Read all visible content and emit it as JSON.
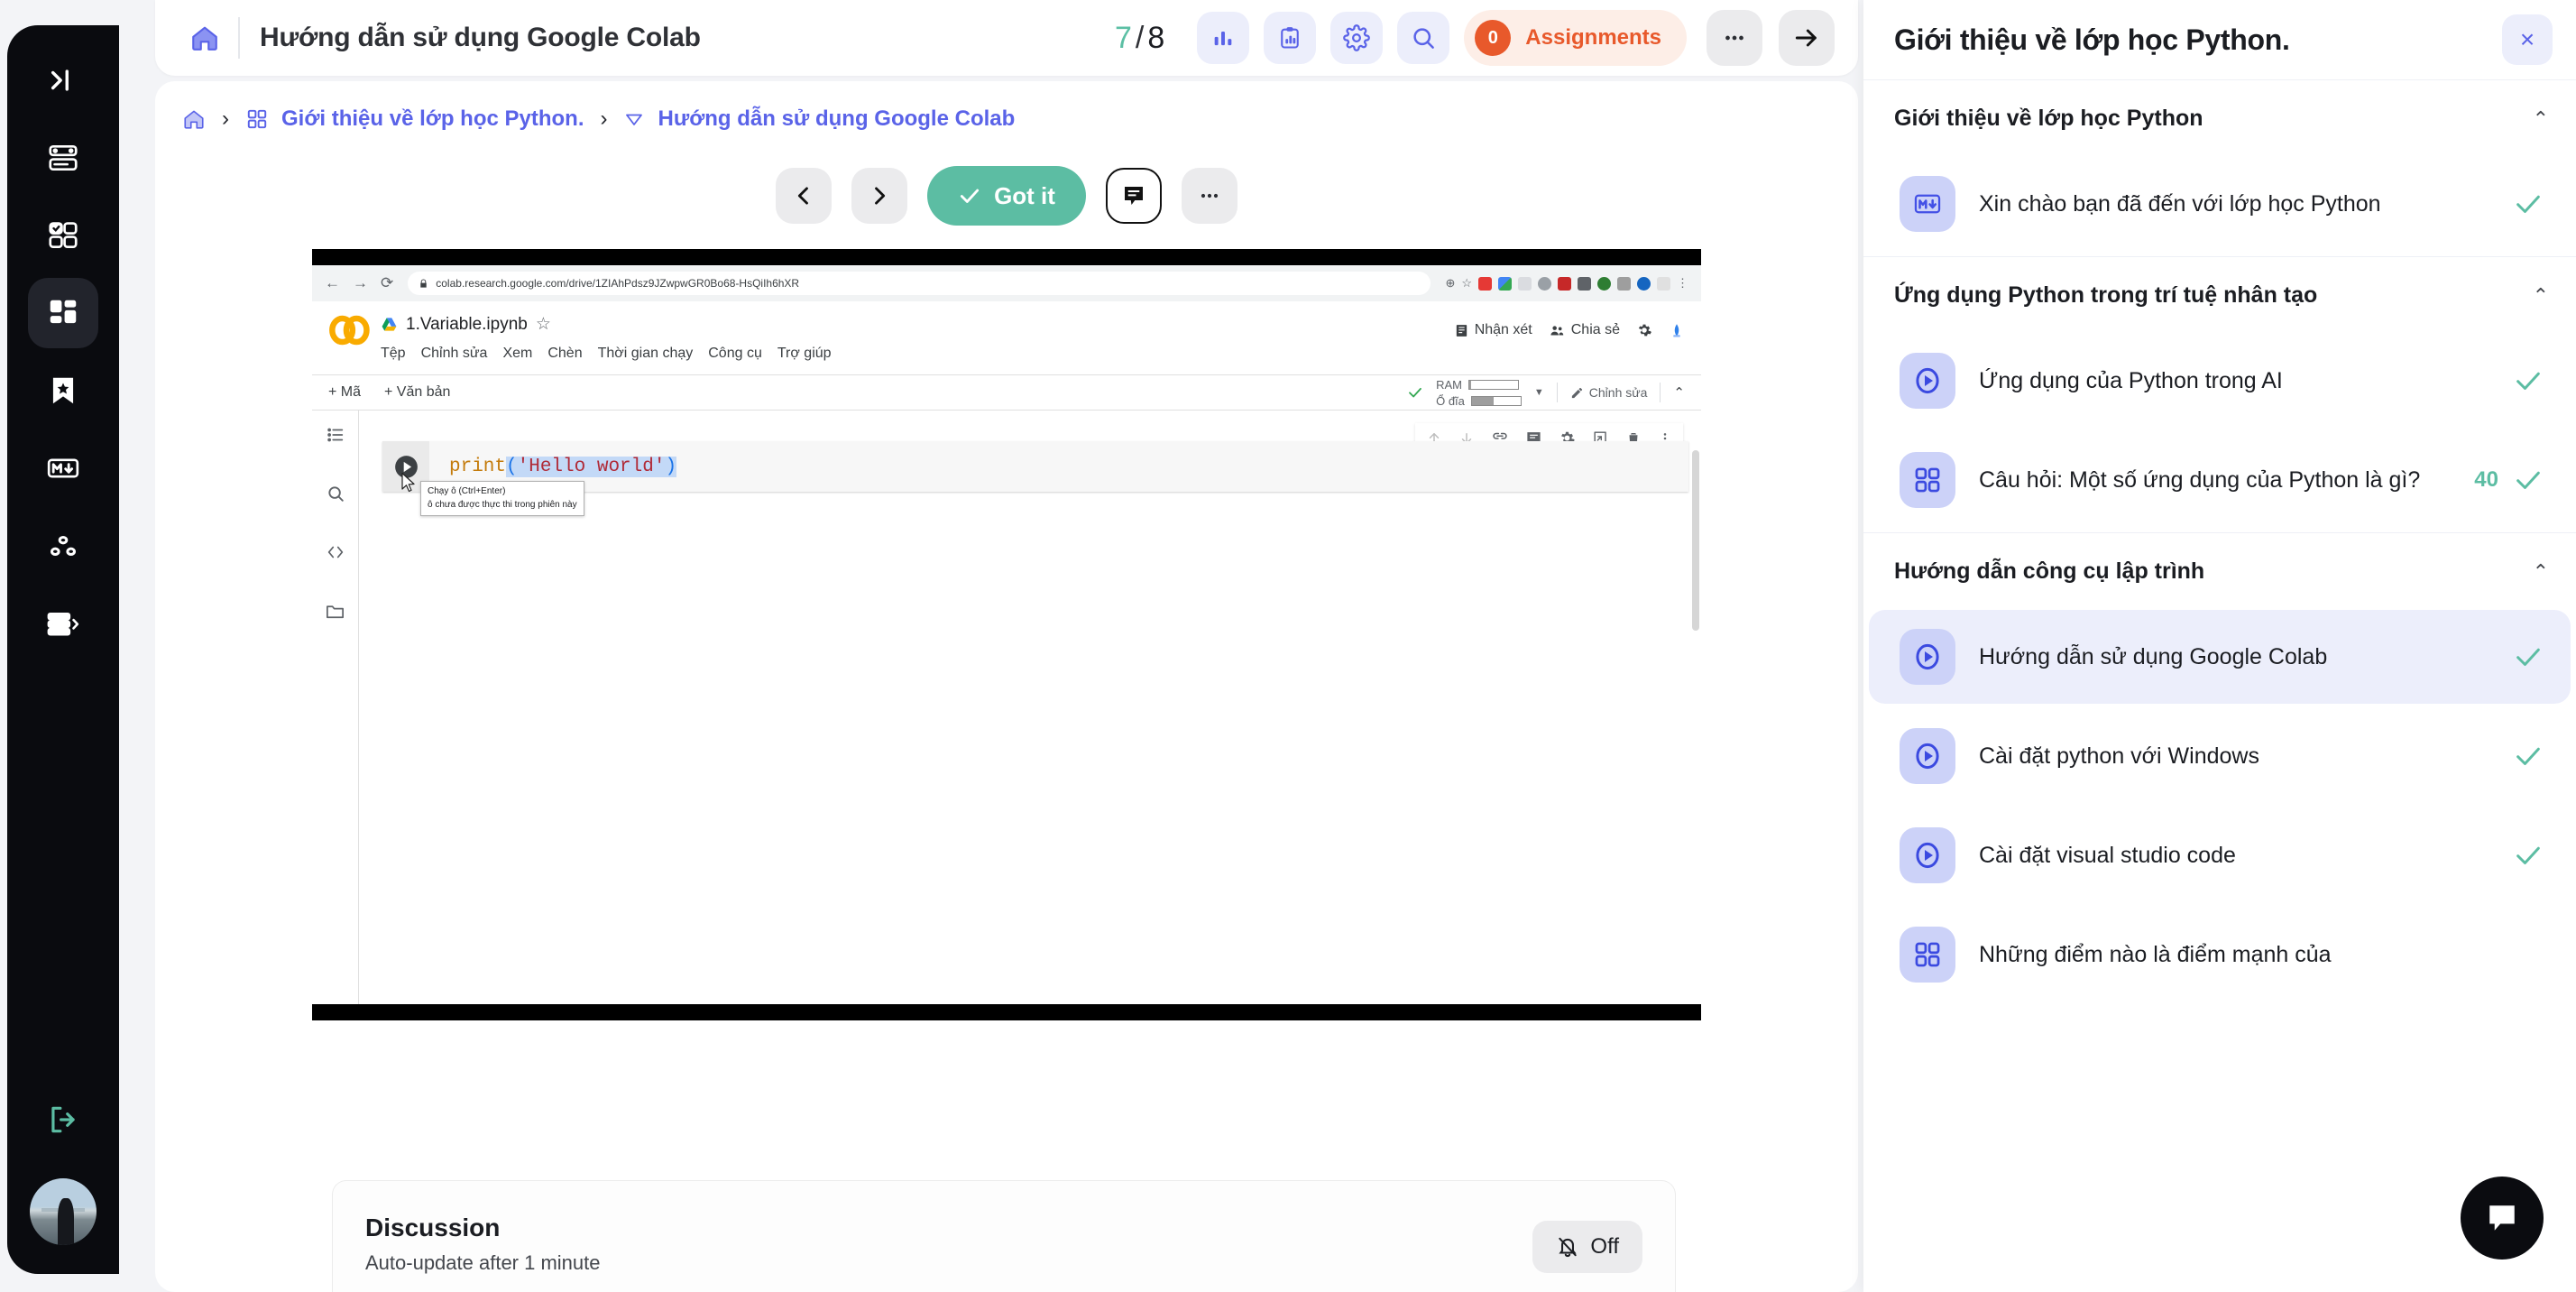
{
  "left_rail": {
    "collapse_icon": "collapse-panel-icon",
    "items": [
      {
        "icon": "server-stack-icon",
        "active": false
      },
      {
        "icon": "checklist-grid-icon",
        "active": false
      },
      {
        "icon": "dashboard-grid-icon",
        "active": true
      },
      {
        "icon": "bookmark-star-icon",
        "active": false
      },
      {
        "icon": "markdown-icon",
        "active": false
      },
      {
        "icon": "nodes-icon",
        "active": false
      },
      {
        "icon": "list-expand-icon",
        "active": false
      }
    ],
    "logout_icon": "logout-icon",
    "avatar": "user-avatar"
  },
  "topbar": {
    "home_icon": "home-icon",
    "title": "Hướng dẫn sử dụng Google Colab",
    "page_current": "7",
    "page_sep": "/",
    "page_total": "8",
    "buttons": [
      {
        "icon": "bar-chart-icon"
      },
      {
        "icon": "report-clipboard-icon"
      },
      {
        "icon": "gear-icon"
      },
      {
        "icon": "search-icon"
      }
    ],
    "assignments": {
      "count": "0",
      "label": "Assignments"
    },
    "more_label": "•••",
    "forward_icon": "arrow-right-icon"
  },
  "breadcrumb": {
    "home_icon": "home-icon",
    "sep": "›",
    "items": [
      {
        "icon": "grid-icon",
        "label": "Giới thiệu về lớp học Python."
      },
      {
        "icon": "triangle-down-icon",
        "label": "Hướng dẫn sử dụng Google Colab"
      }
    ]
  },
  "actions": {
    "prev_icon": "chevron-left-icon",
    "next_icon": "chevron-right-icon",
    "got_it": "Got it",
    "comment_icon": "comment-icon",
    "more_label": "•••"
  },
  "colab": {
    "url": "colab.research.google.com/drive/1ZIAhPdsz9JZwpwGR0Bo68-HsQiIh6hXR",
    "filename": "1.Variable.ipynb",
    "menus": [
      "Tệp",
      "Chỉnh sửa",
      "Xem",
      "Chèn",
      "Thời gian chạy",
      "Công cụ",
      "Trợ giúp"
    ],
    "right_actions": [
      {
        "icon": "comment-icon",
        "label": "Nhận xét"
      },
      {
        "icon": "people-icon",
        "label": "Chia sẻ"
      },
      {
        "icon": "gear-icon",
        "label": ""
      },
      {
        "icon": "account-icon",
        "label": ""
      }
    ],
    "add_code": "+ Mã",
    "add_text": "+ Văn bản",
    "ram_label": "RAM",
    "disk_label": "Ổ đĩa",
    "ram_fill": 2,
    "disk_fill": 45,
    "edit_label": "Chỉnh sửa",
    "code": {
      "fn": "print",
      "open": "(",
      "str": "'Hello world'",
      "close": ")"
    },
    "tooltip_line1": "Chạy ô (Ctrl+Enter)",
    "tooltip_line2": "ô chưa được thực thi trong phiên này",
    "rail_icons": [
      "toc-icon",
      "search-icon",
      "code-snippets-icon",
      "folder-icon"
    ],
    "cell_tools": [
      "arrow-up-icon",
      "arrow-down-icon",
      "link-icon",
      "comment-icon",
      "gear-icon",
      "copy-to-icon",
      "trash-icon",
      "kebab-icon"
    ]
  },
  "discussion": {
    "title": "Discussion",
    "subtitle": "Auto-update after 1 minute",
    "toggle_icon": "bell-off-icon",
    "toggle_label": "Off"
  },
  "panel": {
    "title": "Giới thiệu về lớp học Python.",
    "close_label": "×",
    "sections": [
      {
        "title": "Giới thiệu về lớp học Python",
        "chevron": "⌃",
        "lessons": [
          {
            "icon": "markdown-icon",
            "label": "Xin chào bạn đã đến với lớp học Python",
            "score": "",
            "done": true,
            "current": false
          }
        ]
      },
      {
        "title": "Ứng dụng Python trong trí tuệ nhân tạo",
        "chevron": "⌃",
        "lessons": [
          {
            "icon": "play-icon",
            "label": "Ứng dụng của Python trong AI",
            "score": "",
            "done": true,
            "current": false
          },
          {
            "icon": "quiz-grid-icon",
            "label": "Câu hỏi: Một số ứng dụng của Python là gì?",
            "score": "40",
            "done": true,
            "current": false
          }
        ]
      },
      {
        "title": "Hướng dẫn công cụ lập trình",
        "chevron": "⌃",
        "lessons": [
          {
            "icon": "play-icon",
            "label": "Hướng dẫn sử dụng Google Colab",
            "score": "",
            "done": true,
            "current": true
          },
          {
            "icon": "play-icon",
            "label": "Cài đặt python với Windows",
            "score": "",
            "done": true,
            "current": false
          },
          {
            "icon": "play-icon",
            "label": "Cài đặt visual studio code",
            "score": "",
            "done": true,
            "current": false
          },
          {
            "icon": "quiz-grid-icon",
            "label": "Những điểm nào là điểm mạnh của",
            "score": "",
            "done": false,
            "current": false
          }
        ]
      }
    ],
    "chat_icon": "chat-bubble-icon"
  },
  "colors": {
    "accent_indigo": "#5a63e8",
    "accent_green": "#5cbda3",
    "accent_orange": "#e8592b",
    "rail_dark": "#0a0b0f",
    "panel_highlight": "#eceefb"
  }
}
